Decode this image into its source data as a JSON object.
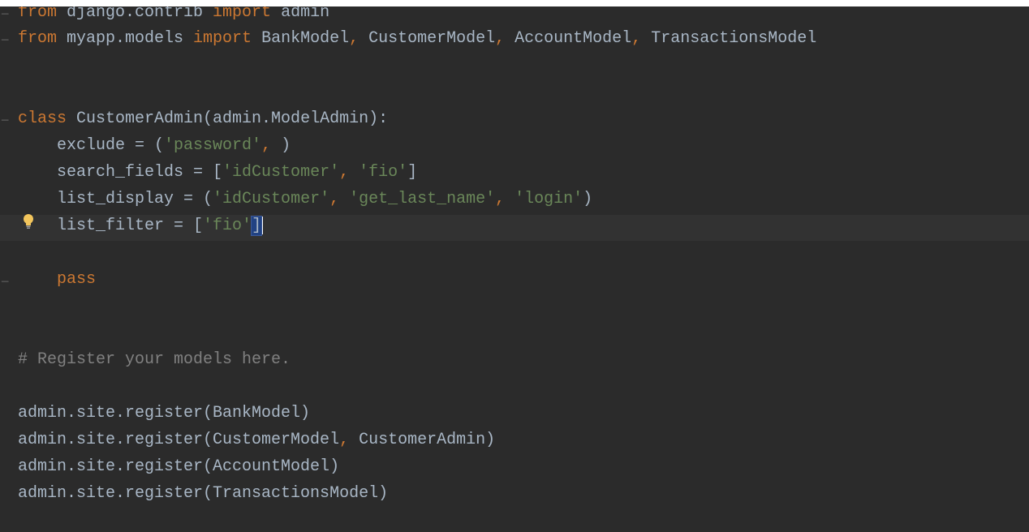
{
  "editor": {
    "colors": {
      "background": "#2b2b2b",
      "current_line": "#323232",
      "default_text": "#a9b7c6",
      "keyword": "#cc7832",
      "string": "#6a8759",
      "comment": "#808080"
    },
    "icons": {
      "intention": "lightbulb-icon",
      "fold": "fold-marker-icon"
    },
    "lines": {
      "l1": {
        "kw1": "from",
        "mod": " django.contrib ",
        "kw2": "import",
        "rest": " admin"
      },
      "l2": {
        "kw1": "from",
        "mod": " myapp.models ",
        "kw2": "import",
        "n1": " BankModel",
        "c1": ",",
        "n2": " CustomerModel",
        "c2": ",",
        "n3": " AccountModel",
        "c3": ",",
        "n4": " TransactionsModel"
      },
      "l5": {
        "kw": "class",
        "rest": " CustomerAdmin(admin.ModelAdmin):"
      },
      "l6": {
        "a": "    exclude = (",
        "s1": "'password'",
        "c1": ",",
        "b": " )"
      },
      "l7": {
        "a": "    search_fields = [",
        "s1": "'idCustomer'",
        "c1": ",",
        "s2": " 'fio'",
        "b": "]"
      },
      "l8": {
        "a": "    list_display = (",
        "s1": "'idCustomer'",
        "c1": ",",
        "s2": " 'get_last_name'",
        "c2": ",",
        "s3": " 'login'",
        "b": ")"
      },
      "l9": {
        "a": "    list_filter = [",
        "s1": "'fio'",
        "b": "]"
      },
      "l11": {
        "kw": "    pass"
      },
      "l14": {
        "cmt": "# Register your models here."
      },
      "l16": {
        "text": "admin.site.register(BankModel)"
      },
      "l17": {
        "a": "admin.site.register(CustomerModel",
        "c1": ",",
        "b": " CustomerAdmin)"
      },
      "l18": {
        "text": "admin.site.register(AccountModel)"
      },
      "l19": {
        "text": "admin.site.register(TransactionsModel)"
      }
    }
  }
}
